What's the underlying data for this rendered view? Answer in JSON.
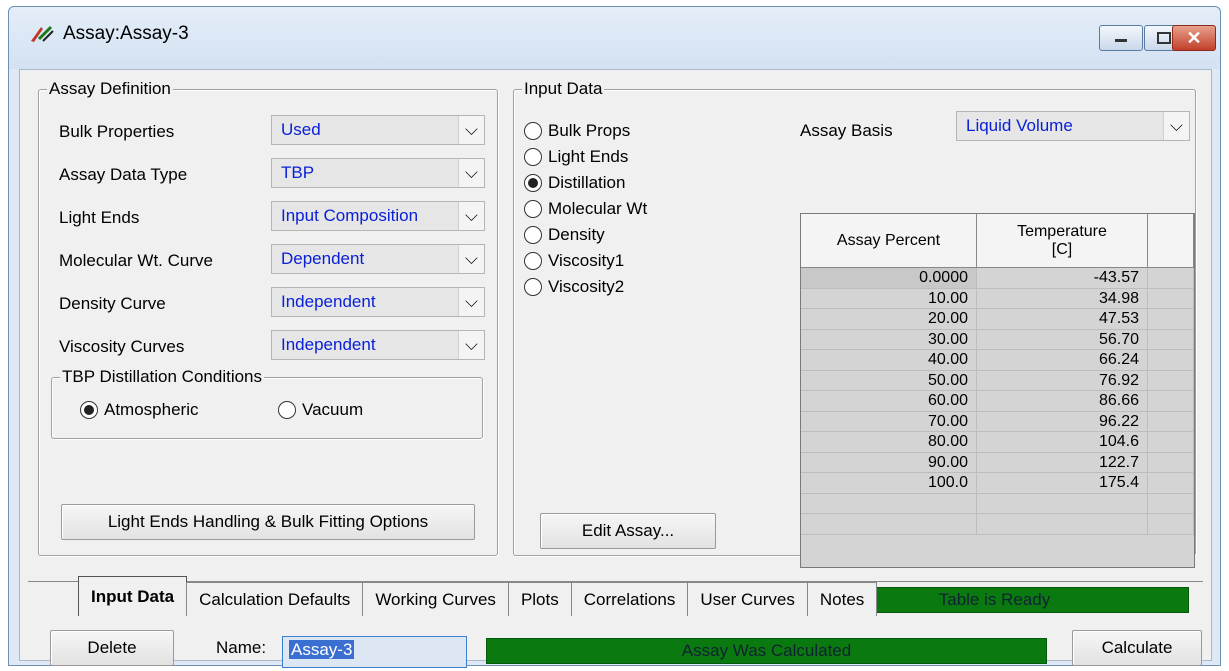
{
  "window": {
    "title": "Assay:Assay-3",
    "controls": [
      "minimize",
      "restore",
      "close"
    ]
  },
  "assay_definition": {
    "legend": "Assay Definition",
    "rows": [
      {
        "label": "Bulk Properties",
        "value": "Used"
      },
      {
        "label": "Assay Data Type",
        "value": "TBP"
      },
      {
        "label": "Light Ends",
        "value": "Input Composition"
      },
      {
        "label": "Molecular Wt. Curve",
        "value": "Dependent"
      },
      {
        "label": "Density Curve",
        "value": "Independent"
      },
      {
        "label": "Viscosity Curves",
        "value": "Independent"
      }
    ],
    "tbp": {
      "legend": "TBP Distillation Conditions",
      "options": [
        {
          "label": "Atmospheric",
          "selected": true
        },
        {
          "label": "Vacuum",
          "selected": false
        }
      ]
    },
    "options_button": "Light Ends Handling & Bulk Fitting Options"
  },
  "input_data": {
    "legend": "Input Data",
    "radios": [
      {
        "label": "Bulk Props",
        "selected": false
      },
      {
        "label": "Light Ends",
        "selected": false
      },
      {
        "label": "Distillation",
        "selected": true
      },
      {
        "label": "Molecular Wt",
        "selected": false
      },
      {
        "label": "Density",
        "selected": false
      },
      {
        "label": "Viscosity1",
        "selected": false
      },
      {
        "label": "Viscosity2",
        "selected": false
      }
    ],
    "assay_basis_label": "Assay Basis",
    "assay_basis_value": "Liquid Volume",
    "table": {
      "headers": [
        "Assay Percent",
        "Temperature",
        "[C]"
      ],
      "rows": [
        [
          "0.0000",
          "-43.57"
        ],
        [
          "10.00",
          "34.98"
        ],
        [
          "20.00",
          "47.53"
        ],
        [
          "30.00",
          "56.70"
        ],
        [
          "40.00",
          "66.24"
        ],
        [
          "50.00",
          "76.92"
        ],
        [
          "60.00",
          "86.66"
        ],
        [
          "70.00",
          "96.22"
        ],
        [
          "80.00",
          "104.6"
        ],
        [
          "90.00",
          "122.7"
        ],
        [
          "100.0",
          "175.4"
        ]
      ]
    },
    "table_status": "Table is Ready",
    "edit_button": "Edit Assay..."
  },
  "tabs": [
    "Input Data",
    "Calculation Defaults",
    "Working Curves",
    "Plots",
    "Correlations",
    "User Curves",
    "Notes"
  ],
  "active_tab": "Input Data",
  "footer": {
    "delete_button": "Delete",
    "name_label": "Name:",
    "name_value": "Assay-3",
    "status": "Assay Was Calculated",
    "calculate_button": "Calculate"
  },
  "colors": {
    "status_green": "#0a7a10",
    "combo_value_blue": "#0a20d8"
  }
}
